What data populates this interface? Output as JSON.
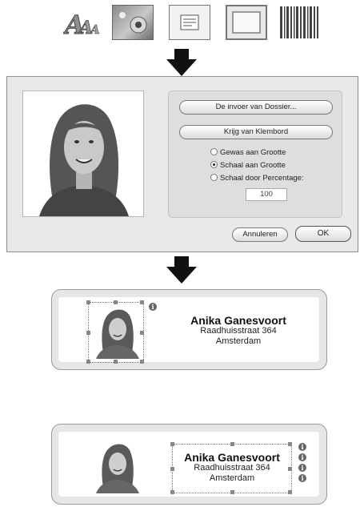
{
  "toolbar": {
    "icons": [
      {
        "name": "text-tool-icon",
        "glyph": "A"
      },
      {
        "name": "image-tool-icon"
      },
      {
        "name": "document-tool-icon"
      },
      {
        "name": "frame-tool-icon"
      },
      {
        "name": "barcode-tool-icon"
      }
    ]
  },
  "dialog": {
    "import_button": "De invoer van Dossier...",
    "clipboard_button": "Krijg van Klembord",
    "radio_options": [
      {
        "label": "Gewas aan Grootte",
        "selected": false
      },
      {
        "label": "Schaal aan Grootte",
        "selected": true
      },
      {
        "label": "Schaal door Percentage:",
        "selected": false
      }
    ],
    "percentage_value": "100",
    "cancel_button": "Annuleren",
    "ok_button": "OK"
  },
  "labels": [
    {
      "name": "Anika Ganesvoort",
      "street": "Raadhuisstraat 364",
      "city": "Amsterdam",
      "selected": "photo"
    },
    {
      "name": "Anika Ganesvoort",
      "street": "Raadhuisstraat 364",
      "city": "Amsterdam",
      "selected": "text"
    }
  ],
  "colors": {
    "dialog_bg": "#e9e9e9",
    "card_border": "#9b9b9b",
    "arrow": "#111111"
  }
}
